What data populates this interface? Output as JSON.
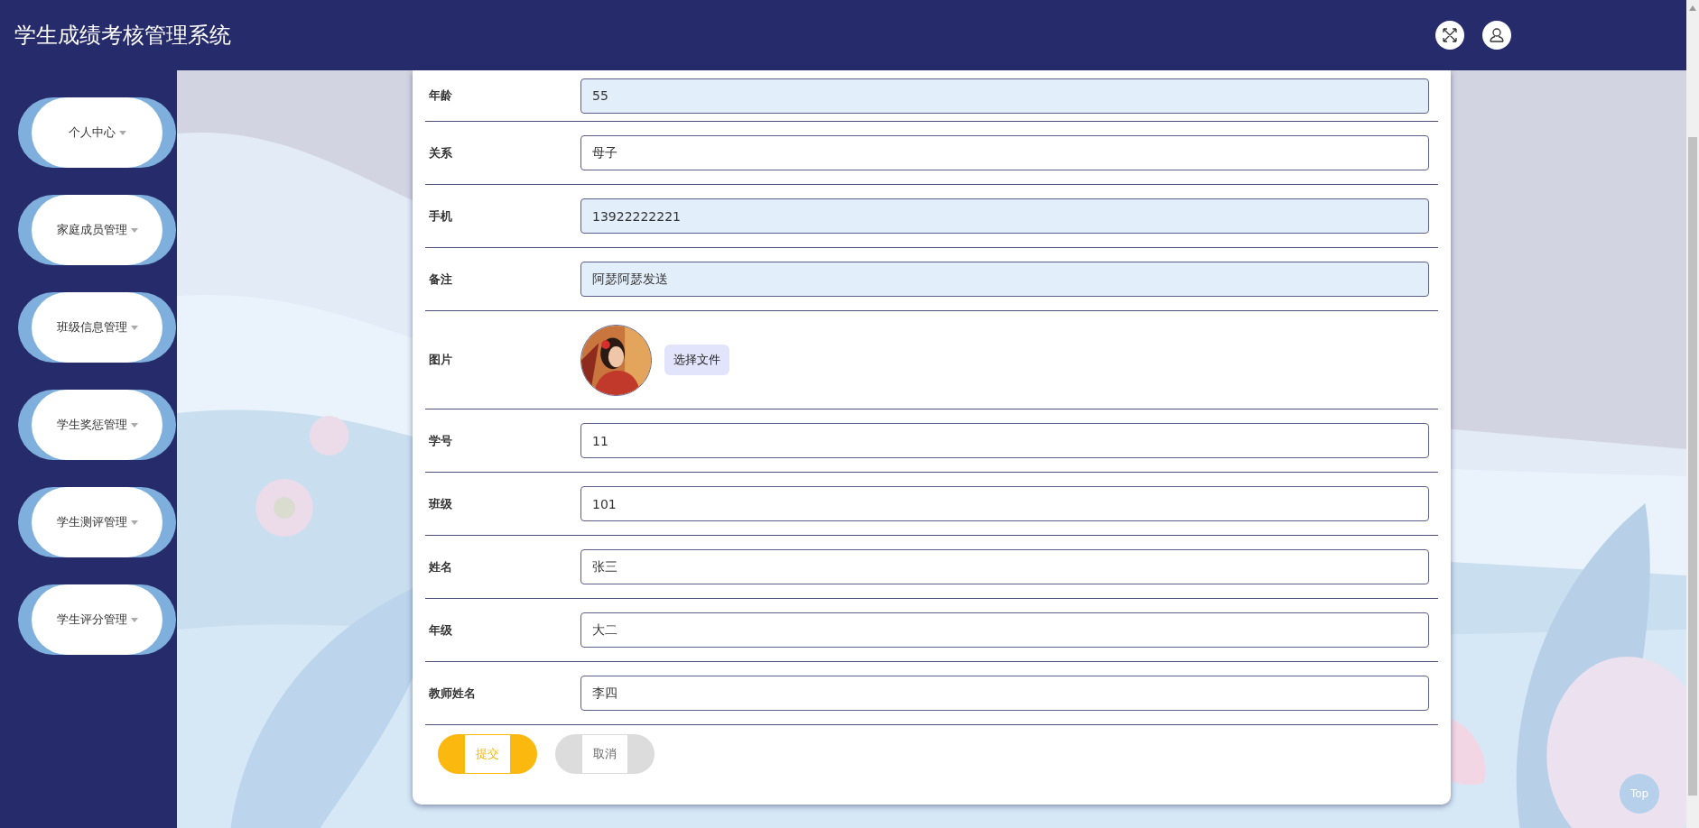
{
  "header": {
    "title": "学生成绩考核管理系统"
  },
  "sidebar": {
    "items": [
      {
        "label": "个人中心"
      },
      {
        "label": "家庭成员管理"
      },
      {
        "label": "班级信息管理"
      },
      {
        "label": "学生奖惩管理"
      },
      {
        "label": "学生测评管理"
      },
      {
        "label": "学生评分管理"
      }
    ]
  },
  "form": {
    "fields": [
      {
        "kind": "text",
        "label": "年龄",
        "value": "55",
        "autofilled": true
      },
      {
        "kind": "text",
        "label": "关系",
        "value": "母子",
        "autofilled": false
      },
      {
        "kind": "text",
        "label": "手机",
        "value": "13922222221",
        "autofilled": true
      },
      {
        "kind": "text",
        "label": "备注",
        "value": "阿瑟阿瑟发送",
        "autofilled": true
      },
      {
        "label": "图片",
        "button": "选择文件"
      },
      {
        "kind": "text",
        "label": "学号",
        "value": "11",
        "autofilled": false
      },
      {
        "kind": "text",
        "label": "班级",
        "value": "101",
        "autofilled": false
      },
      {
        "kind": "text",
        "label": "姓名",
        "value": "张三",
        "autofilled": false
      },
      {
        "kind": "text",
        "label": "年级",
        "value": "大二",
        "autofilled": false
      },
      {
        "kind": "text",
        "label": "教师姓名",
        "value": "李四",
        "autofilled": false
      }
    ],
    "buttons": [
      {
        "label": "提交",
        "kind": "primary"
      },
      {
        "label": "取消",
        "kind": "secondary"
      }
    ]
  },
  "back_to_top": "Top"
}
